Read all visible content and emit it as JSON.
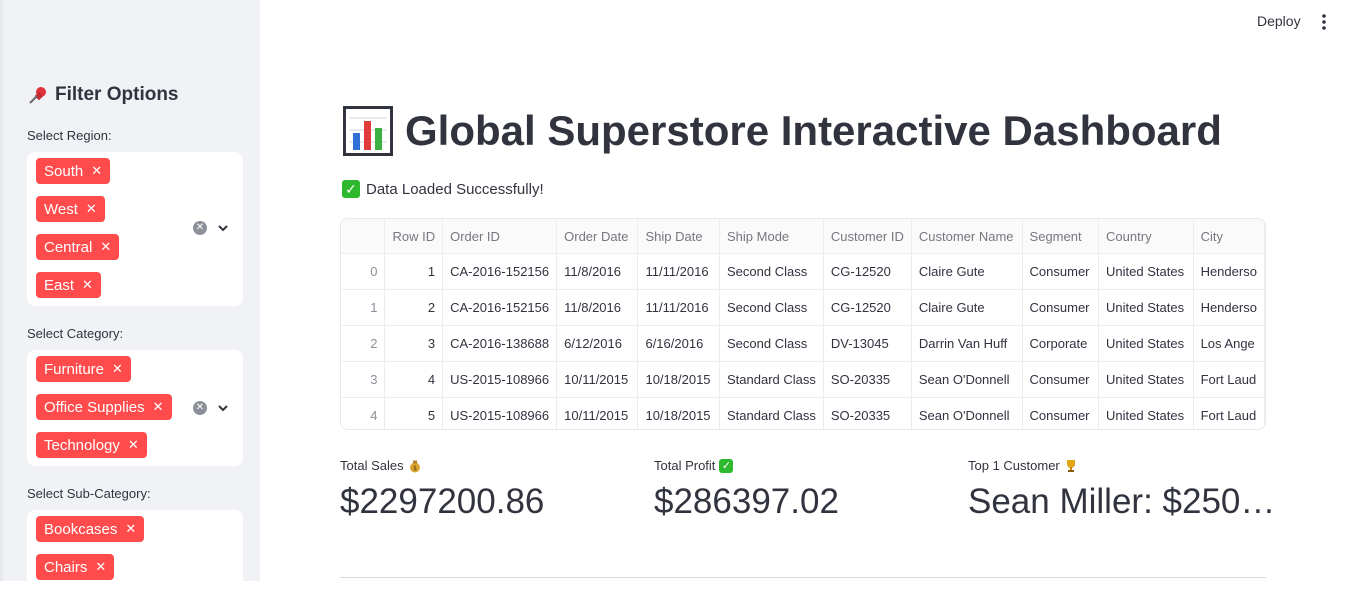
{
  "sidebar": {
    "title": "Filter Options",
    "region": {
      "label": "Select Region:",
      "tags": [
        "South",
        "West",
        "Central",
        "East"
      ]
    },
    "category": {
      "label": "Select Category:",
      "tags": [
        "Furniture",
        "Office Supplies",
        "Technology"
      ]
    },
    "subcategory": {
      "label": "Select Sub-Category:",
      "tags": [
        "Bookcases",
        "Chairs"
      ]
    }
  },
  "header": {
    "deploy_label": "Deploy"
  },
  "main": {
    "title": "Global Superstore Interactive Dashboard",
    "status": "Data Loaded Successfully!",
    "table": {
      "columns": [
        "",
        "Row ID",
        "Order ID",
        "Order Date",
        "Ship Date",
        "Ship Mode",
        "Customer ID",
        "Customer Name",
        "Segment",
        "Country",
        "City"
      ],
      "rows": [
        [
          "0",
          "1",
          "CA-2016-152156",
          "11/8/2016",
          "11/11/2016",
          "Second Class",
          "CG-12520",
          "Claire Gute",
          "Consumer",
          "United States",
          "Henderso"
        ],
        [
          "1",
          "2",
          "CA-2016-152156",
          "11/8/2016",
          "11/11/2016",
          "Second Class",
          "CG-12520",
          "Claire Gute",
          "Consumer",
          "United States",
          "Henderso"
        ],
        [
          "2",
          "3",
          "CA-2016-138688",
          "6/12/2016",
          "6/16/2016",
          "Second Class",
          "DV-13045",
          "Darrin Van Huff",
          "Corporate",
          "United States",
          "Los Ange"
        ],
        [
          "3",
          "4",
          "US-2015-108966",
          "10/11/2015",
          "10/18/2015",
          "Standard Class",
          "SO-20335",
          "Sean O'Donnell",
          "Consumer",
          "United States",
          "Fort Laud"
        ],
        [
          "4",
          "5",
          "US-2015-108966",
          "10/11/2015",
          "10/18/2015",
          "Standard Class",
          "SO-20335",
          "Sean O'Donnell",
          "Consumer",
          "United States",
          "Fort Laud"
        ]
      ]
    },
    "metrics": [
      {
        "label": "Total Sales",
        "value": "$2297200.86",
        "icon": "money-bag-icon"
      },
      {
        "label": "Total Profit",
        "value": "$286397.02",
        "icon": "check-icon"
      },
      {
        "label": "Top 1 Customer",
        "value": "Sean Miller: $250…",
        "icon": "trophy-icon"
      }
    ]
  },
  "colors": {
    "accent": "#ff4b4b",
    "sidebar_bg": "#f0f2f6",
    "text": "#31333f"
  }
}
